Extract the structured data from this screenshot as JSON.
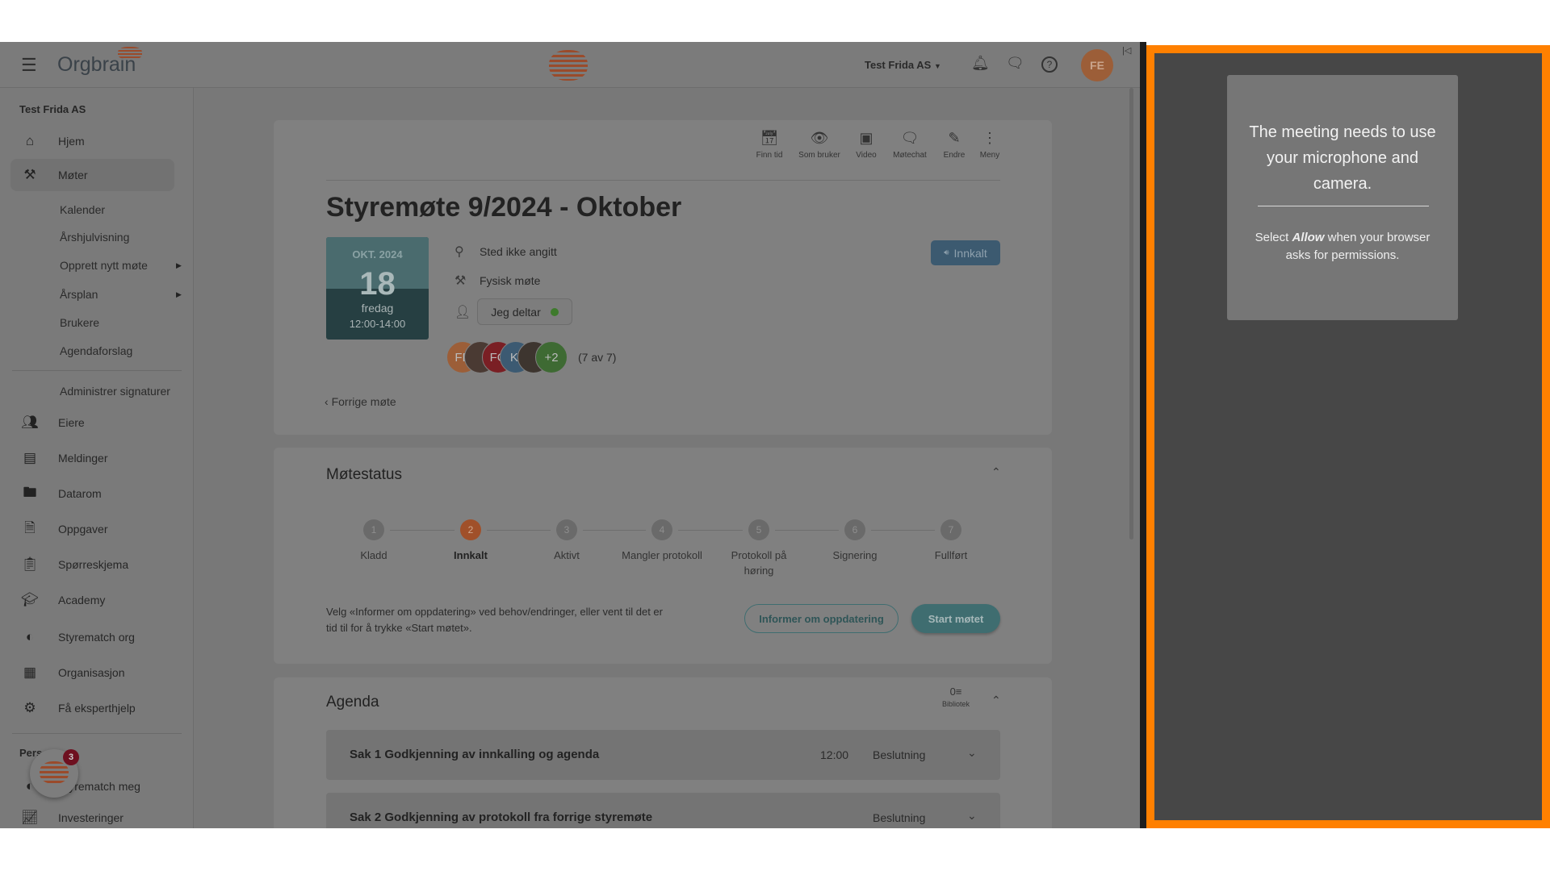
{
  "header": {
    "logo_text": "Orgbrain",
    "org_selector": "Test Frida AS",
    "avatar_initials": "FE"
  },
  "sidebar": {
    "org_name": "Test Frida AS",
    "items": [
      {
        "label": "Hjem",
        "icon": "home-icon"
      },
      {
        "label": "Møter",
        "icon": "gavel-icon",
        "selected": true
      },
      {
        "label": "Eiere",
        "icon": "people-icon"
      },
      {
        "label": "Meldinger",
        "icon": "messages-icon"
      },
      {
        "label": "Datarom",
        "icon": "folder-icon"
      },
      {
        "label": "Oppgaver",
        "icon": "task-icon"
      },
      {
        "label": "Spørreskjema",
        "icon": "survey-icon"
      },
      {
        "label": "Academy",
        "icon": "graduation-cap-icon"
      },
      {
        "label": "Styrematch org",
        "icon": "styrematch-icon"
      },
      {
        "label": "Organisasjon",
        "icon": "building-icon"
      },
      {
        "label": "Få eksperthjelp",
        "icon": "expert-icon"
      }
    ],
    "meeting_subitems": [
      "Kalender",
      "Årshjulvisning",
      "Opprett nytt møte",
      "Årsplan",
      "Brukere",
      "Agendaforslag"
    ],
    "admin_signatures": "Administrer signaturer",
    "personal_heading": "Pers",
    "personal_items": [
      {
        "label": "Styrematch meg"
      },
      {
        "label": "Investeringer"
      }
    ],
    "chat_badge_count": "3"
  },
  "meeting": {
    "toolbar": [
      "Finn tid",
      "Som bruker",
      "Video",
      "Møtechat",
      "Endre",
      "Meny"
    ],
    "title": "Styremøte 9/2024 - Oktober",
    "date": {
      "month_year": "OKT. 2024",
      "day": "18",
      "weekday": "fredag",
      "time": "12:00-14:00"
    },
    "location": "Sted ikke angitt",
    "meeting_type": "Fysisk møte",
    "attend_button": "Jeg deltar",
    "status_button": "Innkalt",
    "participants": [
      {
        "initials": "FE",
        "color": "#9c5e38"
      },
      {
        "initials": "",
        "color": "#4a3a33"
      },
      {
        "initials": "FO",
        "color": "#7a1f24"
      },
      {
        "initials": "KI",
        "color": "#3c5a72"
      },
      {
        "initials": "",
        "color": "#3d352f"
      },
      {
        "initials": "+2",
        "color": "#3e6a33"
      }
    ],
    "participant_count": "(7 av 7)",
    "previous_link": "Forrige møte"
  },
  "status": {
    "title": "Møtestatus",
    "steps": [
      "Kladd",
      "Innkalt",
      "Aktivt",
      "Mangler protokoll",
      "Protokoll på høring",
      "Signering",
      "Fullført"
    ],
    "current_step": 2,
    "description": "Velg «Informer om oppdatering» ved behov/endringer, eller vent til det er tid til for å trykke «Start møtet».",
    "inform_button": "Informer om oppdatering",
    "start_button": "Start møtet"
  },
  "agenda": {
    "title": "Agenda",
    "library_label": "Bibliotek",
    "items": [
      {
        "title": "Sak 1 Godkjenning av innkalling og agenda",
        "time": "12:00",
        "type": "Beslutning"
      },
      {
        "title": "Sak 2 Godkjenning av protokoll fra forrige styremøte",
        "time": "",
        "type": "Beslutning"
      }
    ]
  },
  "video_panel": {
    "heading": "The meeting needs to use your microphone and camera.",
    "instruction_prefix": "Select ",
    "instruction_emphasis": "Allow",
    "instruction_suffix": " when your browser asks for permissions.",
    "highlight_color": "#ff8000"
  }
}
